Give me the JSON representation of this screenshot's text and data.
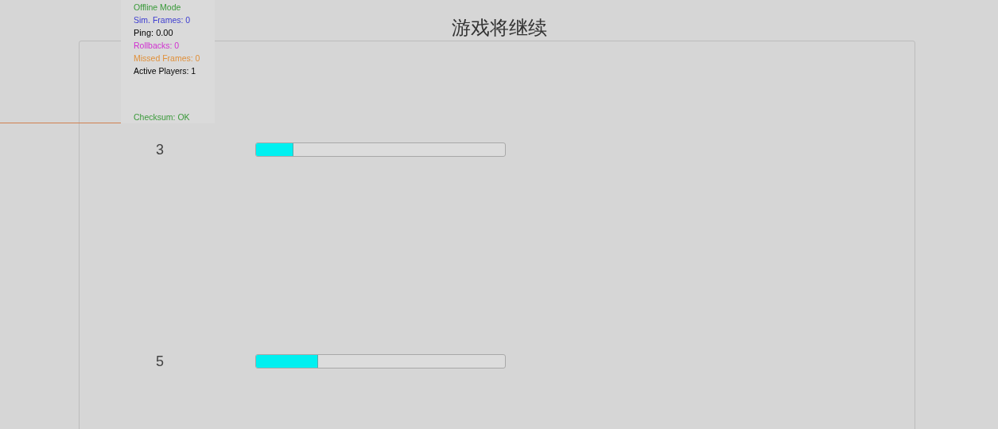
{
  "title": "游戏将继续",
  "debug": {
    "lines": [
      {
        "text": "Offline Mode",
        "color": "#3a9a3a"
      },
      {
        "text": "Sim. Frames: 0",
        "color": "#3c3cd0"
      },
      {
        "text": "Ping: 0.00",
        "color": "#000000"
      },
      {
        "text": "Rollbacks: 0",
        "color": "#d030d0"
      },
      {
        "text": "Missed Frames: 0",
        "color": "#e0903a"
      },
      {
        "text": "Active Players: 1",
        "color": "#000000"
      }
    ],
    "checksum": {
      "text": "Checksum: OK",
      "color": "#3a9a3a"
    }
  },
  "rows": [
    {
      "label": "3",
      "level": 0.15
    },
    {
      "label": "5",
      "level": 0.25
    }
  ]
}
